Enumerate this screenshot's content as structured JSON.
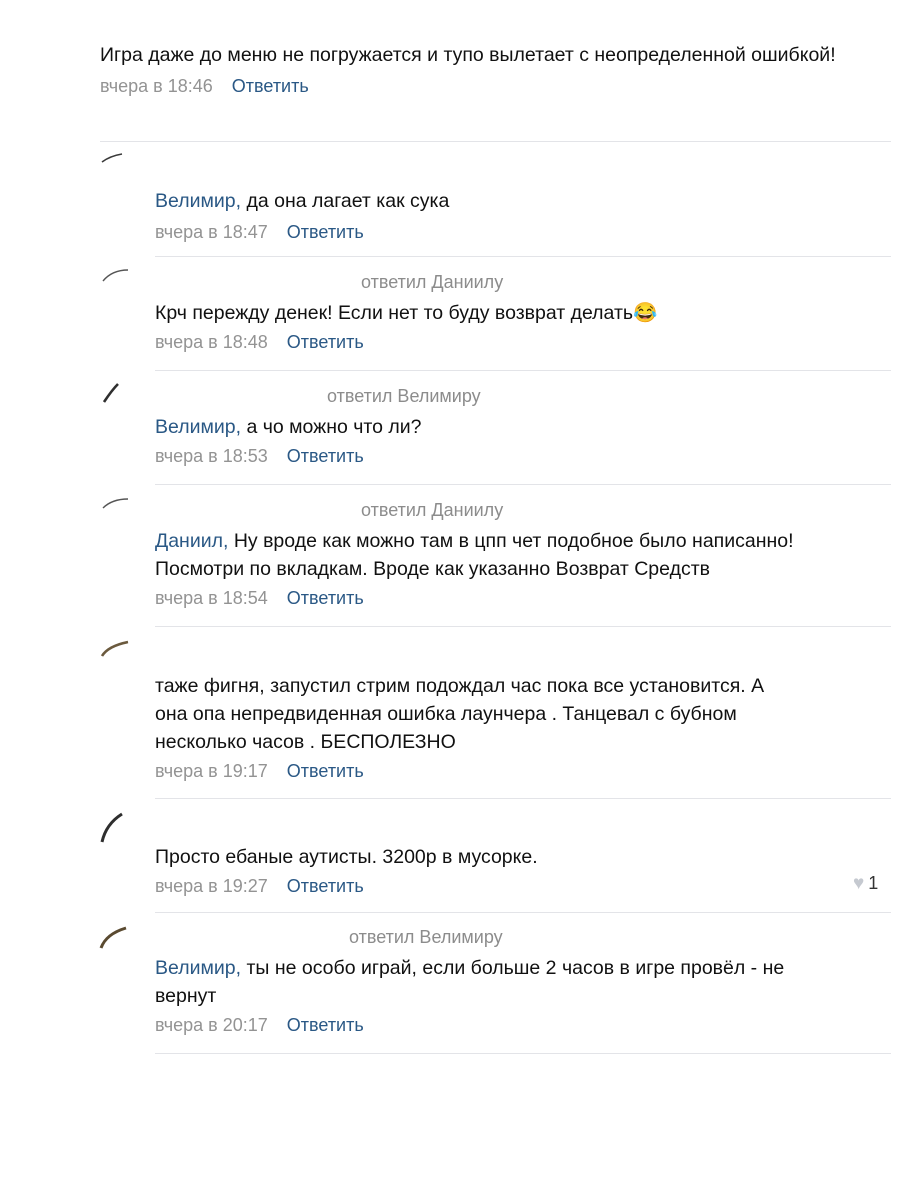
{
  "comments": [
    {
      "text": "Игра даже до меню не погружается и тупо вылетает с неопределенной ошибкой!",
      "time": "вчера в 18:46",
      "reply_label": "Ответить"
    },
    {
      "mention": "Велимир,",
      "text": " да она лагает как сука",
      "time": "вчера в 18:47",
      "reply_label": "Ответить"
    },
    {
      "replied_to": "ответил Даниилу",
      "text": "Крч пережду денек! Если нет то буду возврат делать😂",
      "time": "вчера в 18:48",
      "reply_label": "Ответить"
    },
    {
      "replied_to": "ответил Велимиру",
      "mention": "Велимир,",
      "text": " а чо можно что ли?",
      "time": "вчера в 18:53",
      "reply_label": "Ответить"
    },
    {
      "replied_to": "ответил Даниилу",
      "mention": "Даниил,",
      "text_line1": " Ну вроде как можно там в цпп чет подобное было написанно!",
      "text_line2": "Посмотри по вкладкам. Вроде как указанно Возврат Средств",
      "time": "вчера в 18:54",
      "reply_label": "Ответить"
    },
    {
      "text_line1": "таже фигня, запустил стрим подождал час пока все установится. А",
      "text_line2": "она опа непредвиденная ошибка лаунчера . Танцевал с бубном",
      "text_line3": "несколько часов . БЕСПОЛЕЗНО",
      "time": "вчера в 19:17",
      "reply_label": "Ответить"
    },
    {
      "text": "Просто ебаные аутисты. 3200р в мусорке.",
      "time": "вчера в 19:27",
      "reply_label": "Ответить",
      "likes": "1"
    },
    {
      "replied_to": "ответил Велимиру",
      "mention": "Велимир,",
      "text_line1": " ты не особо играй, если больше 2 часов в игре провёл - не",
      "text_line2": "вернут",
      "time": "вчера в 20:17",
      "reply_label": "Ответить"
    }
  ],
  "icons": {
    "like": "heart-icon",
    "avatar": "avatar-feather-icon"
  },
  "colors": {
    "link": "#2a5885",
    "meta": "#939393",
    "divider": "#e3e4e8",
    "text": "#111111"
  }
}
